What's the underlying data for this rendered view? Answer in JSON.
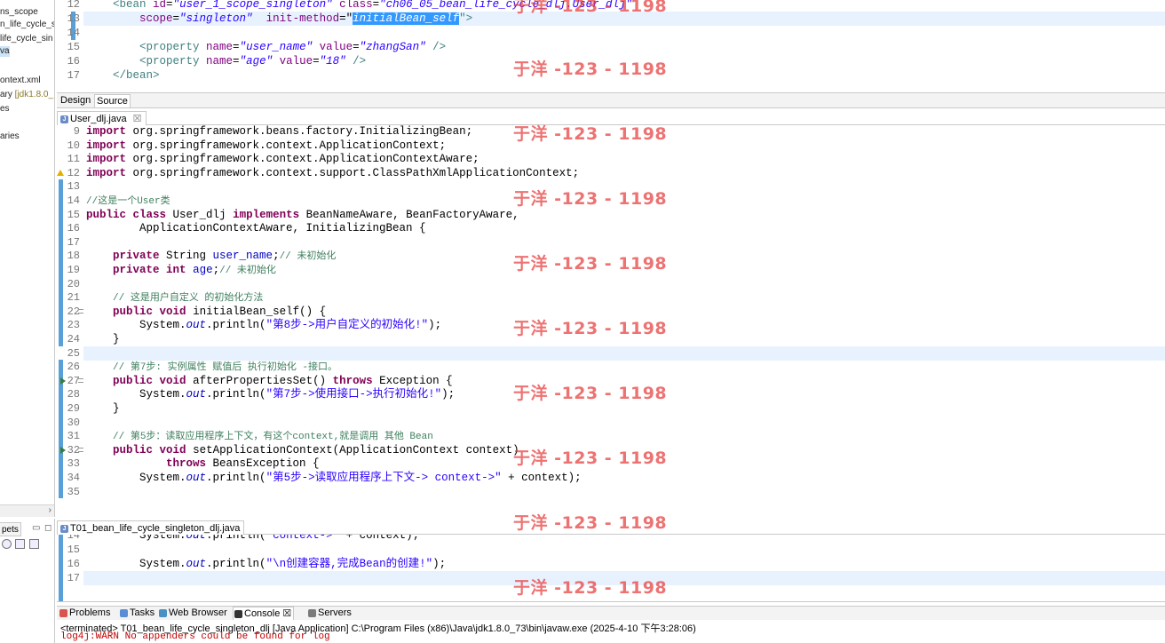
{
  "left_panel": {
    "items": [
      {
        "label": "ns_scope",
        "selected": false
      },
      {
        "label": "n_life_cycle_s",
        "selected": false
      },
      {
        "label": "life_cycle_sin",
        "selected": false
      },
      {
        "label": "va",
        "selected": true
      },
      {
        "label": "ontext.xml",
        "selected": false
      },
      {
        "label": "ary",
        "suffix": "[jdk1.8.0_",
        "selected": false
      },
      {
        "label": "es",
        "selected": false
      },
      {
        "label": "aries",
        "selected": false
      }
    ],
    "scroll_arrow": "›",
    "snippets_tab": "pets"
  },
  "xml_editor": {
    "lines": [
      {
        "num": "12",
        "parts": [
          {
            "t": "    "
          },
          {
            "t": "<bean ",
            "c": "xml-tag"
          },
          {
            "t": "id",
            "c": "xml-attr"
          },
          {
            "t": "="
          },
          {
            "t": "\"user_1_scope_singleton\"",
            "c": "xml-val"
          },
          {
            "t": " "
          },
          {
            "t": "class",
            "c": "xml-attr"
          },
          {
            "t": "="
          },
          {
            "t": "\"ch06_05_bean_life_cycle_dlj.User_dlj\"",
            "c": "xml-val"
          }
        ]
      },
      {
        "num": "13",
        "parts": [
          {
            "t": "        "
          },
          {
            "t": "scope",
            "c": "xml-attr"
          },
          {
            "t": "="
          },
          {
            "t": "\"singleton\"",
            "c": "xml-val"
          },
          {
            "t": "  "
          },
          {
            "t": "init-method",
            "c": "xml-attr"
          },
          {
            "t": "=\""
          },
          {
            "t": "initialBean_self",
            "c": "xml-sel"
          },
          {
            "t": "\">",
            "c": "xml-tag"
          }
        ]
      },
      {
        "num": "14",
        "parts": []
      },
      {
        "num": "15",
        "parts": [
          {
            "t": "        "
          },
          {
            "t": "<property ",
            "c": "xml-tag"
          },
          {
            "t": "name",
            "c": "xml-attr"
          },
          {
            "t": "="
          },
          {
            "t": "\"user_name\"",
            "c": "xml-val"
          },
          {
            "t": " "
          },
          {
            "t": "value",
            "c": "xml-attr"
          },
          {
            "t": "="
          },
          {
            "t": "\"zhangSan\"",
            "c": "xml-val"
          },
          {
            "t": " />",
            "c": "xml-tag"
          }
        ]
      },
      {
        "num": "16",
        "parts": [
          {
            "t": "        "
          },
          {
            "t": "<property ",
            "c": "xml-tag"
          },
          {
            "t": "name",
            "c": "xml-attr"
          },
          {
            "t": "="
          },
          {
            "t": "\"age\"",
            "c": "xml-val"
          },
          {
            "t": " "
          },
          {
            "t": "value",
            "c": "xml-attr"
          },
          {
            "t": "="
          },
          {
            "t": "\"18\"",
            "c": "xml-val"
          },
          {
            "t": " />",
            "c": "xml-tag"
          }
        ]
      },
      {
        "num": "17",
        "parts": [
          {
            "t": "    "
          },
          {
            "t": "</bean>",
            "c": "xml-tag"
          }
        ]
      }
    ],
    "tabs": [
      "Design",
      "Source"
    ],
    "active_tab": "Source"
  },
  "java_editor": {
    "tab_label": "User_dlj.java",
    "tab_close": "☒",
    "lines": [
      {
        "num": "9",
        "parts": [
          {
            "t": "import",
            "c": "k"
          },
          {
            "t": " org.springframework.beans.factory.InitializingBean;"
          }
        ]
      },
      {
        "num": "10",
        "parts": [
          {
            "t": "import",
            "c": "k"
          },
          {
            "t": " org.springframework.context.ApplicationContext;"
          }
        ]
      },
      {
        "num": "11",
        "parts": [
          {
            "t": "import",
            "c": "k"
          },
          {
            "t": " org.springframework.context.ApplicationContextAware;"
          }
        ]
      },
      {
        "num": "12",
        "warn": true,
        "parts": [
          {
            "t": "import",
            "c": "k"
          },
          {
            "t": " org.springframework.context.support.ClassPathXmlApplicationContext;"
          }
        ]
      },
      {
        "num": "13",
        "parts": []
      },
      {
        "num": "14",
        "parts": [
          {
            "t": "//这是一个User类",
            "c": "c"
          }
        ]
      },
      {
        "num": "15",
        "parts": [
          {
            "t": "public",
            "c": "k"
          },
          {
            "t": " "
          },
          {
            "t": "class",
            "c": "k"
          },
          {
            "t": " User_dlj "
          },
          {
            "t": "implements",
            "c": "k"
          },
          {
            "t": " BeanNameAware, BeanFactoryAware,"
          }
        ]
      },
      {
        "num": "16",
        "parts": [
          {
            "t": "        ApplicationContextAware, InitializingBean {"
          }
        ]
      },
      {
        "num": "17",
        "parts": []
      },
      {
        "num": "18",
        "parts": [
          {
            "t": "    "
          },
          {
            "t": "private",
            "c": "k"
          },
          {
            "t": " String "
          },
          {
            "t": "user_name",
            "c": "f"
          },
          {
            "t": ";"
          },
          {
            "t": "// 未初始化",
            "c": "c"
          }
        ]
      },
      {
        "num": "19",
        "parts": [
          {
            "t": "    "
          },
          {
            "t": "private",
            "c": "k"
          },
          {
            "t": " "
          },
          {
            "t": "int",
            "c": "k"
          },
          {
            "t": " "
          },
          {
            "t": "age",
            "c": "f"
          },
          {
            "t": ";"
          },
          {
            "t": "// 未初始化",
            "c": "c"
          }
        ]
      },
      {
        "num": "20",
        "parts": []
      },
      {
        "num": "21",
        "parts": [
          {
            "t": "    "
          },
          {
            "t": "// 这是用户自定义 的初始化方法",
            "c": "c"
          }
        ]
      },
      {
        "num": "22",
        "fold": true,
        "parts": [
          {
            "t": "    "
          },
          {
            "t": "public",
            "c": "k"
          },
          {
            "t": " "
          },
          {
            "t": "void",
            "c": "k"
          },
          {
            "t": " initialBean_self() {"
          }
        ]
      },
      {
        "num": "23",
        "parts": [
          {
            "t": "        System."
          },
          {
            "t": "out",
            "c": "fi"
          },
          {
            "t": ".println("
          },
          {
            "t": "\"第8步->用户自定义的初始化!\"",
            "c": "s"
          },
          {
            "t": ");"
          }
        ]
      },
      {
        "num": "24",
        "parts": [
          {
            "t": "    }"
          }
        ]
      },
      {
        "num": "25",
        "parts": [],
        "current": true
      },
      {
        "num": "26",
        "parts": [
          {
            "t": "    "
          },
          {
            "t": "// 第7步: 实例属性 赋值后 执行初始化 -接口。",
            "c": "c"
          }
        ]
      },
      {
        "num": "27",
        "fold": true,
        "override": true,
        "parts": [
          {
            "t": "    "
          },
          {
            "t": "public",
            "c": "k"
          },
          {
            "t": " "
          },
          {
            "t": "void",
            "c": "k"
          },
          {
            "t": " afterPropertiesSet() "
          },
          {
            "t": "throws",
            "c": "k"
          },
          {
            "t": " Exception {"
          }
        ]
      },
      {
        "num": "28",
        "parts": [
          {
            "t": "        System."
          },
          {
            "t": "out",
            "c": "fi"
          },
          {
            "t": ".println("
          },
          {
            "t": "\"第7步->使用接口->执行初始化!\"",
            "c": "s"
          },
          {
            "t": ");"
          }
        ]
      },
      {
        "num": "29",
        "parts": [
          {
            "t": "    }"
          }
        ]
      },
      {
        "num": "30",
        "parts": []
      },
      {
        "num": "31",
        "parts": [
          {
            "t": "    "
          },
          {
            "t": "// 第5步：读取应用程序上下文，有这个context,就是调用 其他 Bean",
            "c": "c"
          }
        ]
      },
      {
        "num": "32",
        "fold": true,
        "override": true,
        "parts": [
          {
            "t": "    "
          },
          {
            "t": "public",
            "c": "k"
          },
          {
            "t": " "
          },
          {
            "t": "void",
            "c": "k"
          },
          {
            "t": " setApplicationContext(ApplicationContext context)"
          }
        ]
      },
      {
        "num": "33",
        "parts": [
          {
            "t": "            "
          },
          {
            "t": "throws",
            "c": "k"
          },
          {
            "t": " BeansException {"
          }
        ]
      },
      {
        "num": "34",
        "parts": [
          {
            "t": "        System."
          },
          {
            "t": "out",
            "c": "fi"
          },
          {
            "t": ".println("
          },
          {
            "t": "\"第5步->读取应用程序上下文-> context->\"",
            "c": "s"
          },
          {
            "t": " + context);"
          }
        ]
      },
      {
        "num": "35",
        "parts": []
      }
    ]
  },
  "t01_editor": {
    "tab_label": "T01_bean_life_cycle_singleton_dlj.java",
    "lines": [
      {
        "num": "14",
        "parts": [
          {
            "t": "        System."
          },
          {
            "t": "out",
            "c": "fi"
          },
          {
            "t": ".println("
          },
          {
            "t": "\"context->\"",
            "c": "s"
          },
          {
            "t": " + context);"
          }
        ]
      },
      {
        "num": "15",
        "parts": []
      },
      {
        "num": "16",
        "parts": [
          {
            "t": "        System."
          },
          {
            "t": "out",
            "c": "fi"
          },
          {
            "t": ".println("
          },
          {
            "t": "\"\\n创建容器,完成Bean的创建!\"",
            "c": "s"
          },
          {
            "t": ");"
          }
        ]
      },
      {
        "num": "17",
        "parts": [],
        "current": true
      }
    ]
  },
  "console": {
    "tabs": [
      {
        "label": "Problems",
        "icon_color": "#d9534f",
        "active": false
      },
      {
        "label": "Tasks",
        "icon_color": "#5b8dd6",
        "active": false
      },
      {
        "label": "Web Browser",
        "icon_color": "#4a90c2",
        "active": false
      },
      {
        "label": "Console ☒",
        "icon_color": "#333333",
        "active": true
      },
      {
        "label": "Servers",
        "icon_color": "#7a7a7a",
        "active": false
      }
    ],
    "status": "<terminated> T01_bean_life_cycle_singleton_dlj [Java Application] C:\\Program Files (x86)\\Java\\jdk1.8.0_73\\bin\\javaw.exe (2025-4-10 下午3:28:06)",
    "output": "log4j:WARN No appenders could be found for log"
  },
  "watermark": "于洋 -123 - 1198",
  "colors": {
    "keyword": "#7f0055",
    "string": "#2a00ff",
    "comment": "#3f7f5f",
    "field": "#0000c0",
    "watermark": "#e63c3c",
    "selection": "#3399ff"
  }
}
